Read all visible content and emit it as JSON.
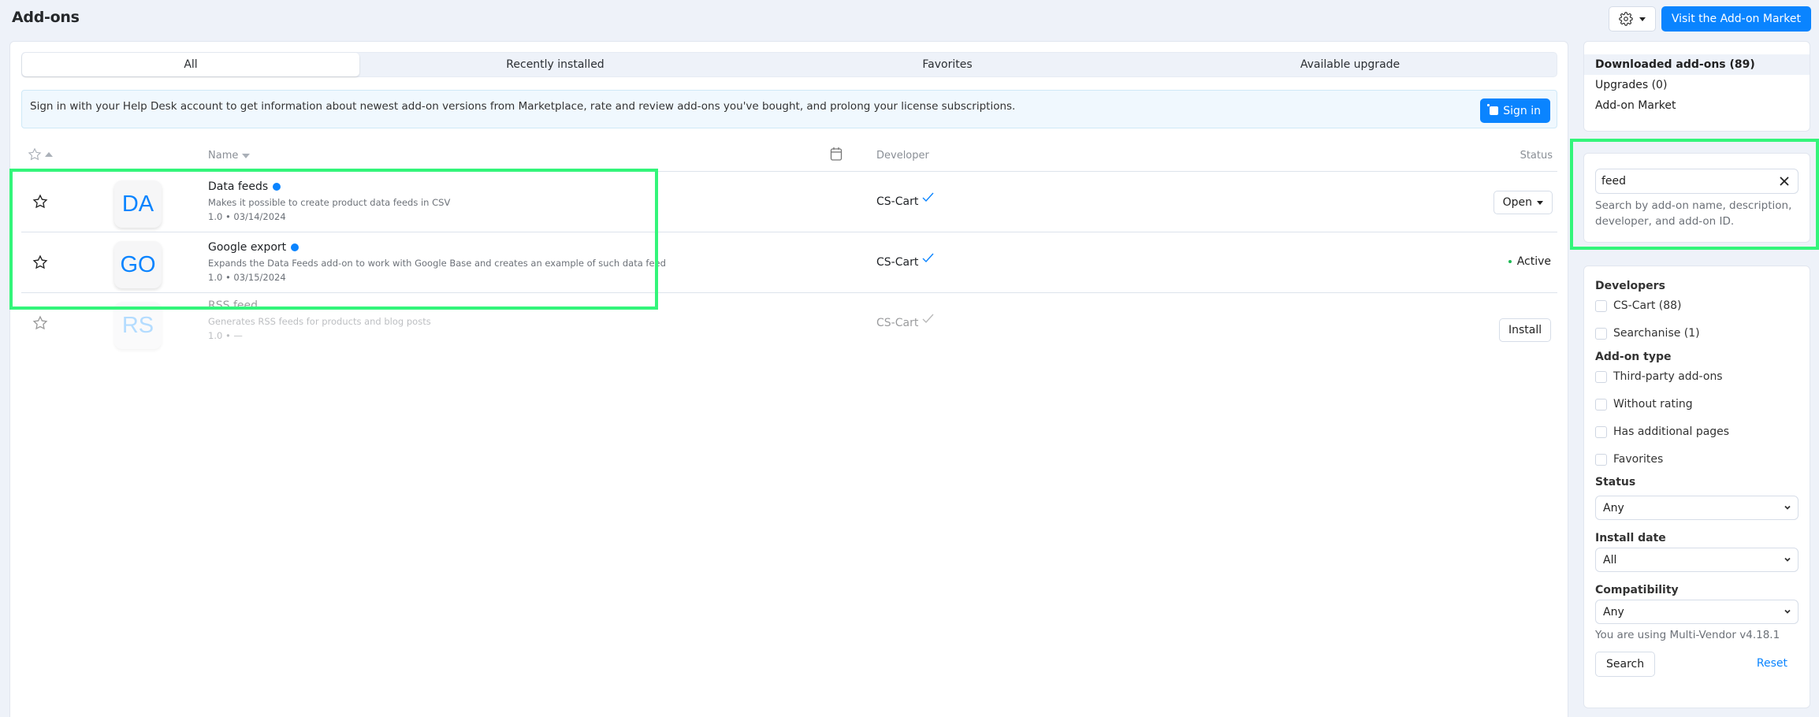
{
  "header": {
    "title": "Add-ons",
    "gear_icon": "gear-icon",
    "visit_market_label": "Visit the Add-on Market"
  },
  "tabs": [
    {
      "label": "All",
      "active": true
    },
    {
      "label": "Recently installed",
      "active": false
    },
    {
      "label": "Favorites",
      "active": false
    },
    {
      "label": "Available upgrade",
      "active": false
    }
  ],
  "alert": {
    "text": "Sign in with your Help Desk account to get information about newest add-on versions from Marketplace, rate and review add-ons you've bought, and prolong your license subscriptions.",
    "signin_label": "Sign in"
  },
  "table": {
    "columns": {
      "favorite_icon": "star-icon",
      "name": "Name",
      "date_icon": "calendar-icon",
      "developer": "Developer",
      "status": "Status"
    },
    "rows": [
      {
        "initials": "DA",
        "name": "Data feeds",
        "description": "Makes it possible to create product data feeds in CSV",
        "meta": "1.0 • 03/14/2024",
        "developer": "CS-Cart",
        "verified": true,
        "status_type": "button-dropdown",
        "status_label": "Open",
        "installed": true
      },
      {
        "initials": "GO",
        "name": "Google export",
        "description": "Expands the Data Feeds add-on to work with Google Base and creates an example of such data feed",
        "meta": "1.0 • 03/15/2024",
        "developer": "CS-Cart",
        "verified": true,
        "status_type": "text",
        "status_label": "Active",
        "installed": true
      },
      {
        "initials": "RS",
        "name": "RSS feed",
        "description": "Generates RSS feeds for products and blog posts",
        "meta": "1.0 • —",
        "developer": "CS-Cart",
        "verified": true,
        "status_type": "button",
        "status_label": "Install",
        "installed": false
      }
    ]
  },
  "sidebar": {
    "nav": [
      {
        "label": "Downloaded add-ons (89)",
        "active": true
      },
      {
        "label": "Upgrades (0)",
        "active": false
      },
      {
        "label": "Add-on Market",
        "active": false
      }
    ],
    "search": {
      "value": "feed",
      "hint": "Search by add-on name, description, developer, and add-on ID."
    },
    "filters": {
      "developers_title": "Developers",
      "developers": [
        {
          "label": "CS-Cart (88)",
          "checked": false
        },
        {
          "label": "Searchanise (1)",
          "checked": false
        }
      ],
      "type_title": "Add-on type",
      "types": [
        {
          "label": "Third-party add-ons",
          "checked": false
        },
        {
          "label": "Without rating",
          "checked": false
        },
        {
          "label": "Has additional pages",
          "checked": false
        },
        {
          "label": "Favorites",
          "checked": false
        }
      ],
      "status_title": "Status",
      "status_value": "Any",
      "install_date_title": "Install date",
      "install_date_value": "All",
      "compatibility_title": "Compatibility",
      "compatibility_value": "Any",
      "version_note": "You are using Multi-Vendor v4.18.1",
      "search_label": "Search",
      "reset_label": "Reset"
    }
  },
  "colors": {
    "accent": "#0a84ff",
    "active_status": "#1db954",
    "highlight": "#33f57a"
  }
}
